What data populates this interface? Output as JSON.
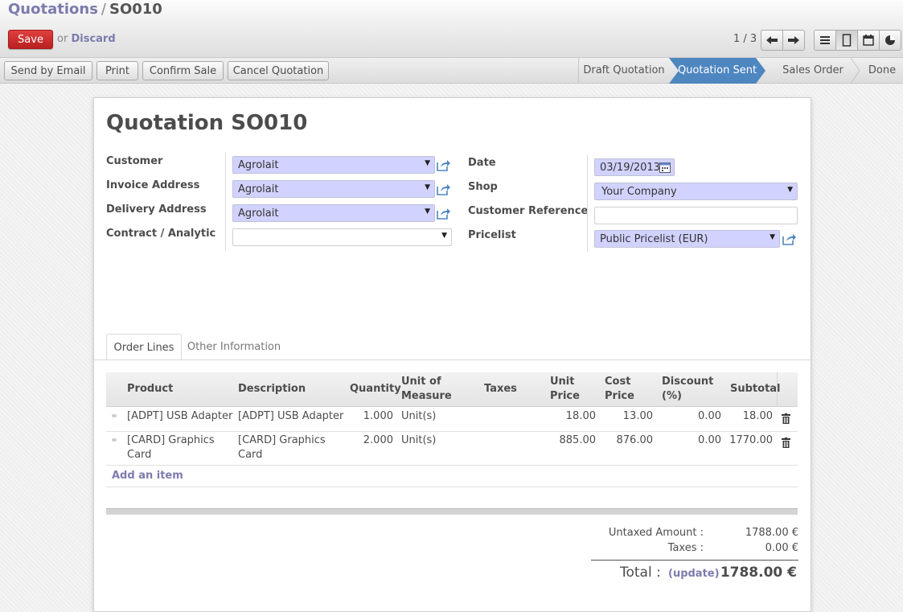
{
  "breadcrumb": {
    "parent": "Quotations",
    "separator": "/",
    "current": "SO010"
  },
  "toolbar": {
    "save_label": "Save",
    "or_label": "or",
    "discard_label": "Discard",
    "pager": "1 / 3"
  },
  "view_icons": [
    "list-view-icon",
    "form-view-icon",
    "calendar-view-icon",
    "graph-view-icon"
  ],
  "actions": [
    "Send by Email",
    "Print",
    "Confirm Sale",
    "Cancel Quotation"
  ],
  "stages": [
    "Draft Quotation",
    "Quotation Sent",
    "Sales Order",
    "Done"
  ],
  "current_stage": "Quotation Sent",
  "form": {
    "title": "Quotation SO010",
    "left_fields": [
      {
        "label": "Customer",
        "value": "Agrolait"
      },
      {
        "label": "Invoice Address",
        "value": "Agrolait"
      },
      {
        "label": "Delivery Address",
        "value": "Agrolait"
      },
      {
        "label": "Contract / Analytic",
        "value": ""
      }
    ],
    "right_fields": {
      "date_label": "Date",
      "date_value": "03/19/2013",
      "shop_label": "Shop",
      "shop_value": "Your Company",
      "customer_ref_label": "Customer Reference",
      "customer_ref_value": "",
      "pricelist_label": "Pricelist",
      "pricelist_value": "Public Pricelist (EUR)"
    }
  },
  "tabs": [
    "Order Lines",
    "Other Information"
  ],
  "order_lines": {
    "headers": {
      "product": "Product",
      "description": "Description",
      "quantity": "Quantity",
      "uom_1": "Unit of",
      "uom_2": "Measure",
      "taxes": "Taxes",
      "unit_price_1": "Unit",
      "unit_price_2": "Price",
      "cost_price_1": "Cost",
      "cost_price_2": "Price",
      "discount_1": "Discount",
      "discount_2": "(%)",
      "subtotal": "Subtotal"
    },
    "rows": [
      {
        "product_1": "[ADPT] USB Adapter",
        "product_2": "",
        "description_1": "[ADPT] USB Adapter",
        "description_2": "",
        "quantity": "1.000",
        "uom": "Unit(s)",
        "taxes": "",
        "unit_price": "18.00",
        "cost_price": "13.00",
        "discount": "0.00",
        "subtotal": "18.00"
      },
      {
        "product_1": "[CARD] Graphics",
        "product_2": "Card",
        "description_1": "[CARD] Graphics",
        "description_2": "Card",
        "quantity": "2.000",
        "uom": "Unit(s)",
        "taxes": "",
        "unit_price": "885.00",
        "cost_price": "876.00",
        "discount": "0.00",
        "subtotal": "1770.00"
      }
    ],
    "add_item": "Add an item"
  },
  "totals": {
    "untaxed_label": "Untaxed Amount :",
    "untaxed_value": "1788.00 €",
    "taxes_label": "Taxes :",
    "taxes_value": "0.00 €",
    "total_label": "Total :",
    "update_label": "(update)",
    "total_value": "1788.00 €"
  },
  "colors": {
    "accent": "#7c7bad",
    "save": "#c9302c",
    "current_stage": "#4e86c0",
    "required_field": "#d2d2ff"
  }
}
